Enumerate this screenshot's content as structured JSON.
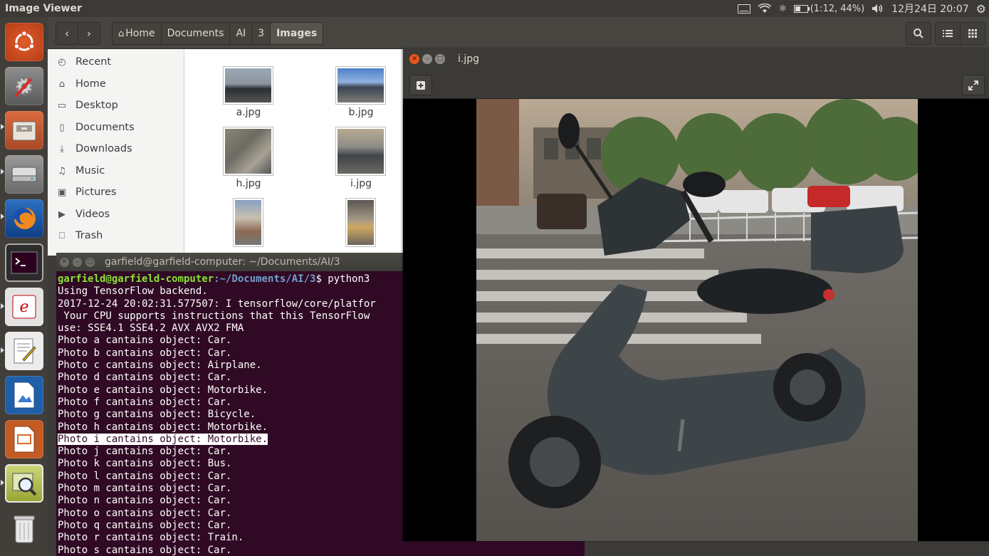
{
  "top_panel": {
    "app_title": "Image Viewer",
    "battery_text": "(1:12, 44%)",
    "datetime": "12月24日 20:07"
  },
  "file_manager": {
    "breadcrumbs": [
      "Home",
      "Documents",
      "AI",
      "3",
      "Images"
    ],
    "sidebar": [
      "Recent",
      "Home",
      "Desktop",
      "Documents",
      "Downloads",
      "Music",
      "Pictures",
      "Videos",
      "Trash"
    ],
    "files": [
      "a.jpg",
      "b.jpg",
      "h.jpg",
      "i.jpg"
    ]
  },
  "terminal": {
    "title": "garfield@garfield-computer: ~/Documents/AI/3",
    "prompt_user": "garfield@garfield-computer",
    "prompt_path": ":~/Documents/AI/3",
    "prompt_cmd": "$ python3",
    "lines": [
      "Using TensorFlow backend.",
      "2017-12-24 20:02:31.577507: I tensorflow/core/platfor",
      " Your CPU supports instructions that this TensorFlow",
      "use: SSE4.1 SSE4.2 AVX AVX2 FMA",
      "Photo a cantains object: Car.",
      "Photo b cantains object: Car.",
      "Photo c cantains object: Airplane.",
      "Photo d cantains object: Car.",
      "Photo e cantains object: Motorbike.",
      "Photo f cantains object: Car.",
      "Photo g cantains object: Bicycle.",
      "Photo h cantains object: Motorbike.",
      "Photo i cantains object: Motorbike.",
      "Photo j cantains object: Car.",
      "Photo k cantains object: Bus.",
      "Photo l cantains object: Car.",
      "Photo m cantains object: Car.",
      "Photo n cantains object: Car.",
      "Photo o cantains object: Car.",
      "Photo q cantains object: Car.",
      "Photo r cantains object: Train.",
      "Photo s cantains object: Car."
    ],
    "highlighted_line": "Photo i cantains object: Motorbike."
  },
  "viewer": {
    "title": "i.jpg"
  }
}
